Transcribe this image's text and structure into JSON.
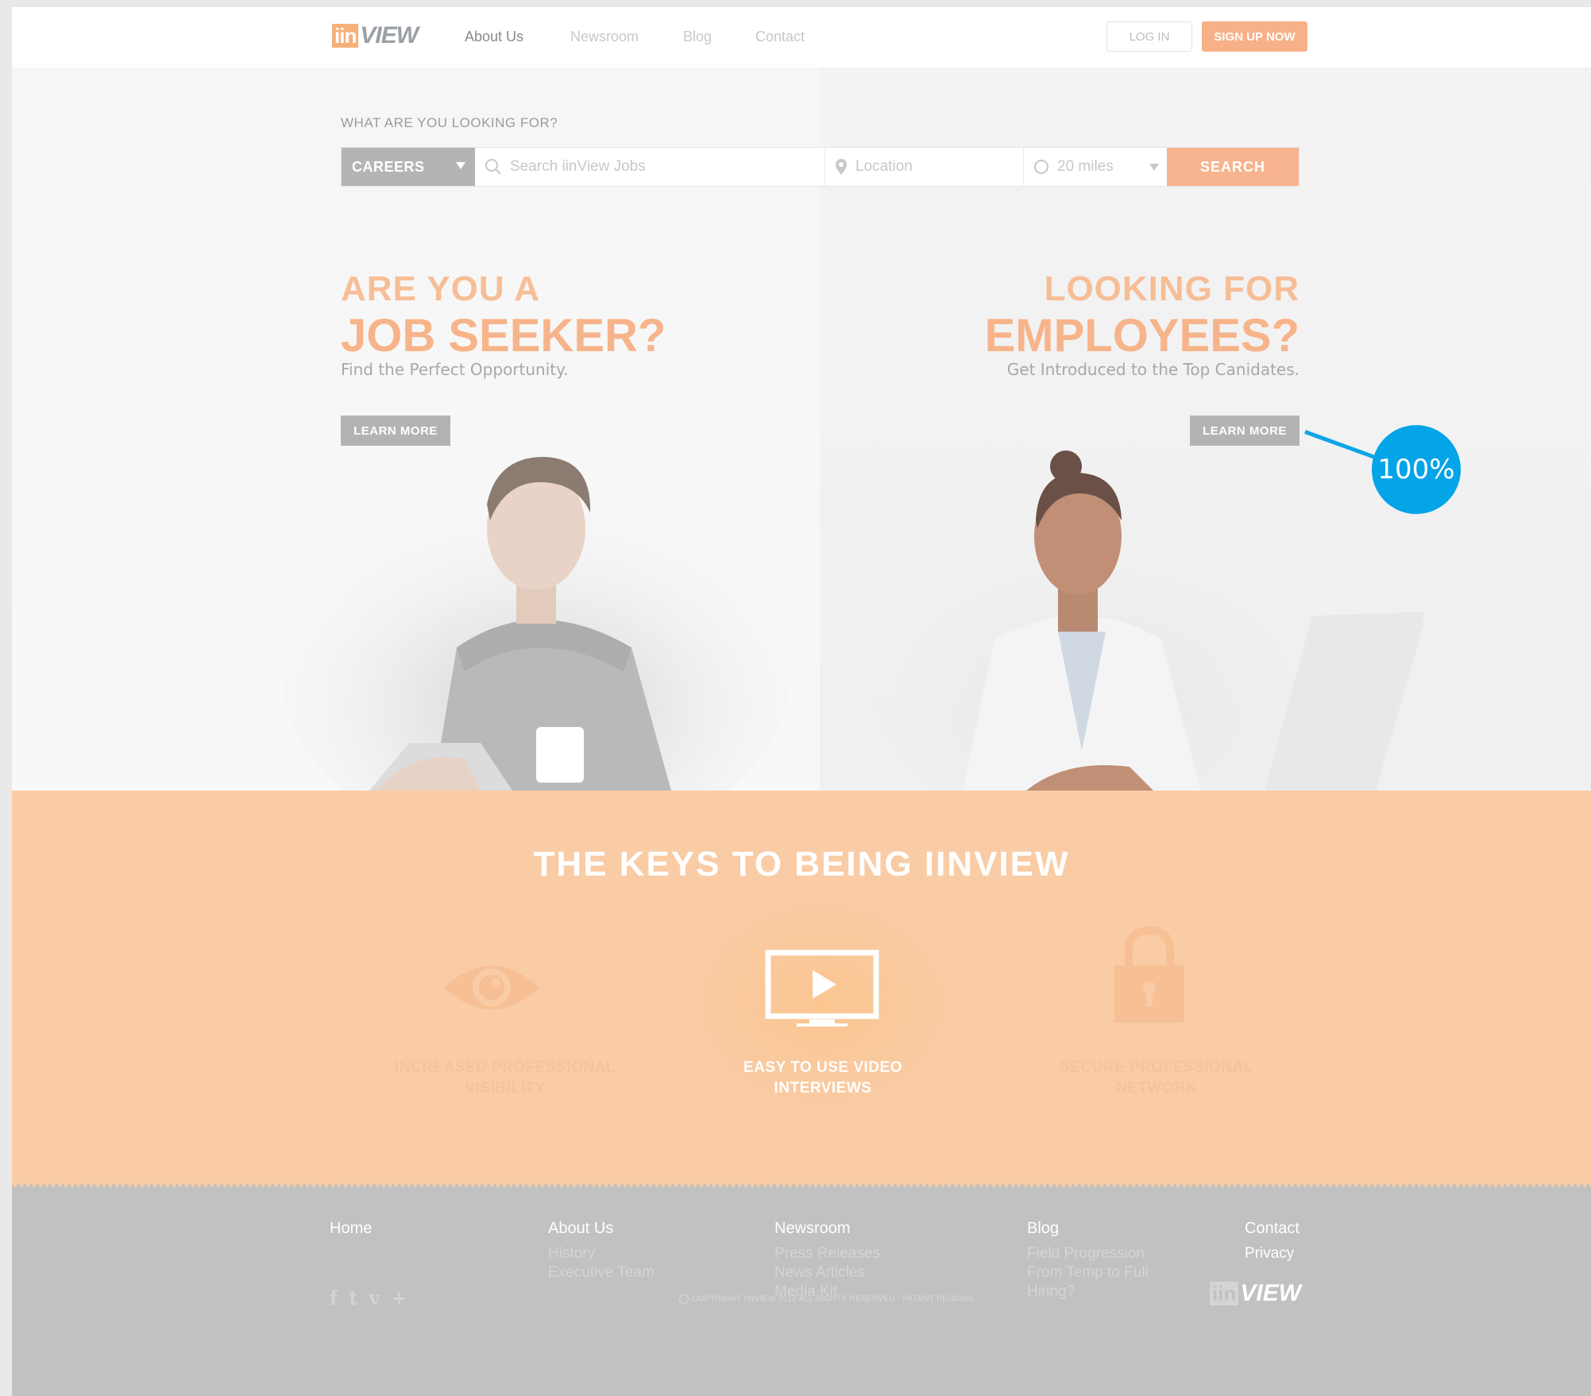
{
  "header": {
    "logo": {
      "mark": "ii",
      "mark2": "n",
      "word": "VIEW"
    },
    "nav": [
      {
        "label": "About Us",
        "active": true
      },
      {
        "label": "Newsroom",
        "active": false
      },
      {
        "label": "Blog",
        "active": false
      },
      {
        "label": "Contact",
        "active": false
      }
    ],
    "login_label": "LOG IN",
    "signup_label": "SIGN UP NOW"
  },
  "search": {
    "question": "WHAT ARE YOU LOOKING FOR?",
    "category": "CAREERS",
    "keyword_placeholder": "Search iinView Jobs",
    "location_placeholder": "Location",
    "radius": "20 miles",
    "button_label": "SEARCH"
  },
  "hero": {
    "seeker": {
      "line1": "ARE YOU A",
      "line2": "JOB SEEKER?",
      "subtitle": "Find the Perfect Opportunity.",
      "button_label": "LEARN MORE"
    },
    "employer": {
      "line1": "LOOKING FOR",
      "line2": "EMPLOYEES?",
      "subtitle": "Get Introduced to the Top Canidates.",
      "button_label": "LEARN MORE"
    }
  },
  "keys": {
    "title": "THE KEYS TO BEING IINVIEW",
    "items": [
      {
        "icon": "eye-icon",
        "line1": "INCREASED PROFESSIONAL",
        "line2": "VISIBILITY",
        "active": false
      },
      {
        "icon": "video-play-icon",
        "line1": "EASY TO USE VIDEO",
        "line2": "INTERVIEWS",
        "active": true
      },
      {
        "icon": "padlock-icon",
        "line1": "SECURE PROFESSIONAL",
        "line2": "NETWORK",
        "active": false
      }
    ]
  },
  "footer": {
    "home": "Home",
    "about": {
      "head": "About Us",
      "items": [
        "History",
        "Executive Team"
      ]
    },
    "newsroom": {
      "head": "Newsroom",
      "items": [
        "Press Releases",
        "News Articles",
        "Media Kit"
      ]
    },
    "blog": {
      "head": "Blog",
      "items": [
        "Field Progression",
        "From Temp to Full",
        "Hiring?"
      ]
    },
    "contact": "Contact",
    "privacy": "Privacy",
    "social": [
      "f",
      "t",
      "v",
      "+"
    ],
    "copyright": "COPYRIGHT IINVIEW 2012 ALL RIGHTS RESERVED - PATENT PENDING",
    "logo": {
      "mark": "ii",
      "mark2": "n",
      "word": "VIEW"
    }
  },
  "zoom_badge": "100%",
  "colors": {
    "accent": "#f7b088",
    "keys_bg": "#f9cca6",
    "footer_bg": "#c1c1c1",
    "badge": "#03a4e8"
  }
}
